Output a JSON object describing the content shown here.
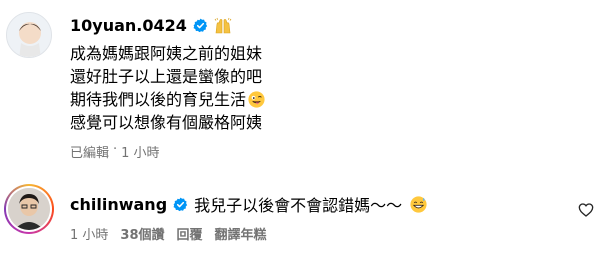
{
  "comments": [
    {
      "username": "10yuan.0424",
      "verified": true,
      "emoji_after_name": "raised-hands",
      "lines": [
        "成為媽媽跟阿姨之前的姐妹",
        "還好肚子以上還是蠻像的吧",
        "期待我們以後的育兒生活",
        "感覺可以想像有個嚴格阿姨"
      ],
      "line3_emoji": "winking-tongue-face",
      "meta_edited": "已編輯",
      "meta_sep": "·",
      "meta_time": "1 小時"
    },
    {
      "username": "chilinwang",
      "verified": true,
      "text": "我兒子以後會不會認錯媽〜〜",
      "text_emoji": "grinning-sweat-face",
      "meta_time": "1 小時",
      "meta_likes": "38個讚",
      "meta_reply": "回覆",
      "meta_translate": "翻譯年糕",
      "like_icon": "heart-outline"
    }
  ],
  "colors": {
    "verified": "#0095f6",
    "meta": "#737373",
    "text": "#000000"
  }
}
